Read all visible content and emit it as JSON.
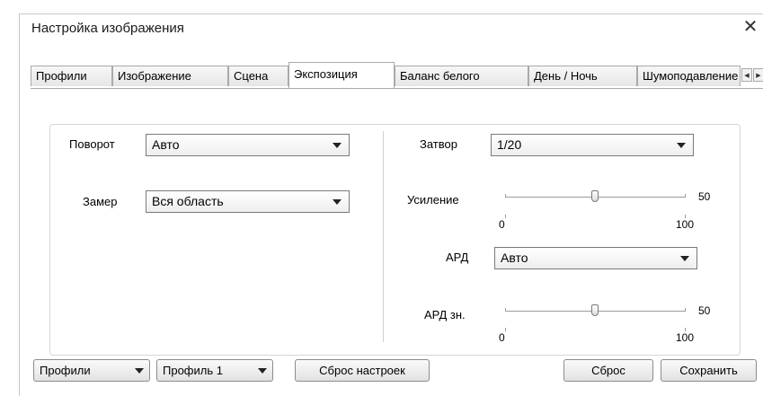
{
  "dialog": {
    "title": "Настройка изображения",
    "close_glyph": "✕"
  },
  "tabs": [
    {
      "label": "Профили",
      "active": false
    },
    {
      "label": "Изображение",
      "active": false
    },
    {
      "label": "Сцена",
      "active": false
    },
    {
      "label": "Экспозиция",
      "active": true
    },
    {
      "label": "Баланс белого",
      "active": false
    },
    {
      "label": "День / Ночь",
      "active": false
    },
    {
      "label": "Шумоподавление",
      "active": false
    }
  ],
  "tab_scroll": {
    "left_glyph": "◀",
    "right_glyph": "▶"
  },
  "exposure": {
    "rotation": {
      "label": "Поворот",
      "value": "Авто"
    },
    "metering": {
      "label": "Замер",
      "value": "Вся область"
    },
    "shutter": {
      "label": "Затвор",
      "value": "1/20"
    },
    "gain": {
      "label": "Усиление",
      "value": "50",
      "min": "0",
      "max": "100",
      "level": 0.5
    },
    "iris": {
      "label": "АРД",
      "value": "Авто"
    },
    "iris_level": {
      "label": "АРД зн.",
      "value": "50",
      "min": "0",
      "max": "100",
      "level": 0.5
    }
  },
  "footer": {
    "profiles_select": "Профили",
    "profile_select": "Профиль 1",
    "reset_settings": "Сброс настроек",
    "reset": "Сброс",
    "save": "Сохранить"
  },
  "colors": {
    "border": "#a9a9a9",
    "panel_border": "#d6d6d6"
  }
}
